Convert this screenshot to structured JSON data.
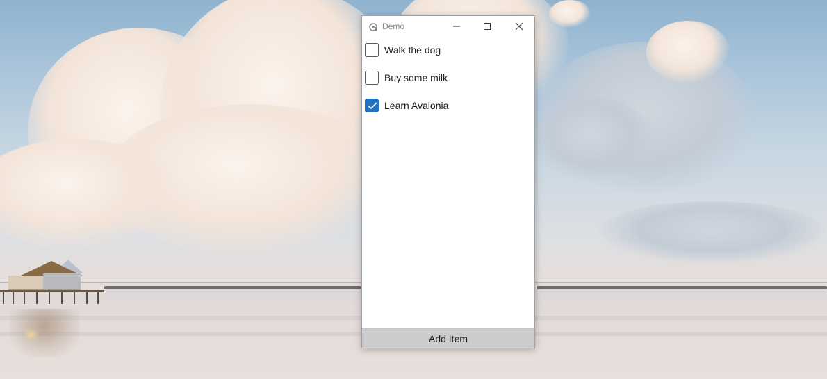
{
  "window": {
    "title": "Demo",
    "icon": "avalonia-logo-icon"
  },
  "caption_buttons": {
    "minimize_icon": "minimize-icon",
    "maximize_icon": "maximize-icon",
    "close_icon": "close-icon"
  },
  "todo": {
    "items": [
      {
        "label": "Walk the dog",
        "checked": false
      },
      {
        "label": "Buy some milk",
        "checked": false
      },
      {
        "label": "Learn Avalonia",
        "checked": true
      }
    ]
  },
  "actions": {
    "add_item_label": "Add Item"
  },
  "colors": {
    "accent": "#1e74c1",
    "button_bg": "#cccccc"
  }
}
